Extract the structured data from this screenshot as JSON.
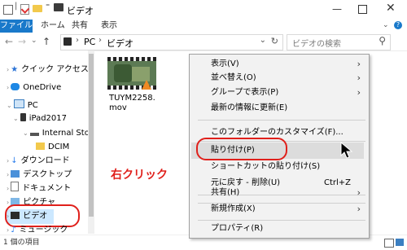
{
  "window": {
    "title": "ビデオ"
  },
  "ribbon": {
    "tabs": [
      "ファイル",
      "ホーム",
      "共有",
      "表示"
    ]
  },
  "address": {
    "path": [
      "PC",
      "ビデオ"
    ],
    "search_placeholder": "ビデオの検索"
  },
  "nav": {
    "items": [
      {
        "label": "クイック アクセス",
        "icon": "star-icon"
      },
      {
        "label": "OneDrive",
        "icon": "cloud-icon"
      },
      {
        "label": "PC",
        "icon": "pc-icon"
      },
      {
        "label": "iPad2017",
        "icon": "tablet-icon"
      },
      {
        "label": "Internal Stor",
        "icon": "drive-icon"
      },
      {
        "label": "DCIM",
        "icon": "folder-icon"
      },
      {
        "label": "ダウンロード",
        "icon": "download-icon"
      },
      {
        "label": "デスクトップ",
        "icon": "desktop-icon"
      },
      {
        "label": "ドキュメント",
        "icon": "document-icon"
      },
      {
        "label": "ピクチャ",
        "icon": "picture-icon"
      },
      {
        "label": "ビデオ",
        "icon": "video-icon"
      },
      {
        "label": "ミュージック",
        "icon": "music-icon"
      }
    ]
  },
  "files": [
    {
      "name_line1": "TUYM2258.",
      "name_line2": "mov"
    }
  ],
  "annotation": {
    "text": "右クリック",
    "color": "#e0201b"
  },
  "context_menu": {
    "items": [
      {
        "label": "表示(V)",
        "submenu": true
      },
      {
        "label": "並べ替え(O)",
        "submenu": true
      },
      {
        "label": "グループで表示(P)",
        "submenu": true
      },
      {
        "label": "最新の情報に更新(E)"
      },
      {
        "label": "このフォルダーのカスタマイズ(F)..."
      },
      {
        "label": "貼り付け(P)",
        "highlighted": true
      },
      {
        "label": "ショートカットの貼り付け(S)"
      },
      {
        "label": "元に戻す - 削除(U)",
        "shortcut": "Ctrl+Z"
      },
      {
        "label": "共有(H)",
        "submenu": true
      },
      {
        "label": "新規作成(X)",
        "submenu": true
      },
      {
        "label": "プロパティ(R)"
      }
    ]
  },
  "status": {
    "item_count": "1 個の項目"
  },
  "colors": {
    "accent": "#1979ca",
    "highlight_ring": "#e0201b"
  }
}
